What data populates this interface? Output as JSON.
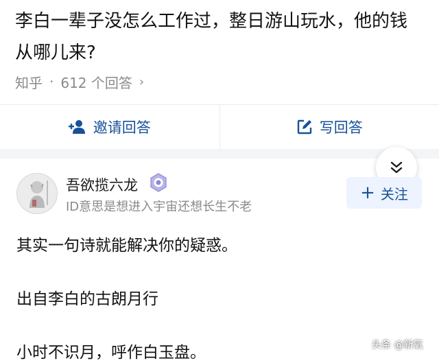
{
  "question": {
    "title": "李白一辈子没怎么工作过，整日游山玩水，他的钱从哪儿来?"
  },
  "meta": {
    "source": "知乎",
    "separator": "·",
    "answer_count": "612 个回答",
    "chevron": "›"
  },
  "actions": {
    "invite_label": "邀请回答",
    "write_label": "写回答"
  },
  "author": {
    "name": "吾欲揽六龙",
    "bio": "ID意思是想进入宇宙还想长生不老",
    "follow_plus": "+",
    "follow_label": "关注"
  },
  "answer": {
    "paragraphs": [
      "其实一句诗就能解决你的疑惑。",
      "出自李白的古朗月行",
      "小时不识月，呼作白玉盘。"
    ]
  },
  "watermark": "头条 @新氧",
  "colors": {
    "link_blue": "#175199",
    "follow_bg": "#edf3ff",
    "meta_gray": "#8a8a8a",
    "divider": "#ebebeb"
  },
  "icons": {
    "invite": "add-person-icon",
    "write": "edit-icon",
    "collapse": "double-chevron-down-icon",
    "badge": "creator-badge-icon",
    "avatar": "user-avatar"
  }
}
